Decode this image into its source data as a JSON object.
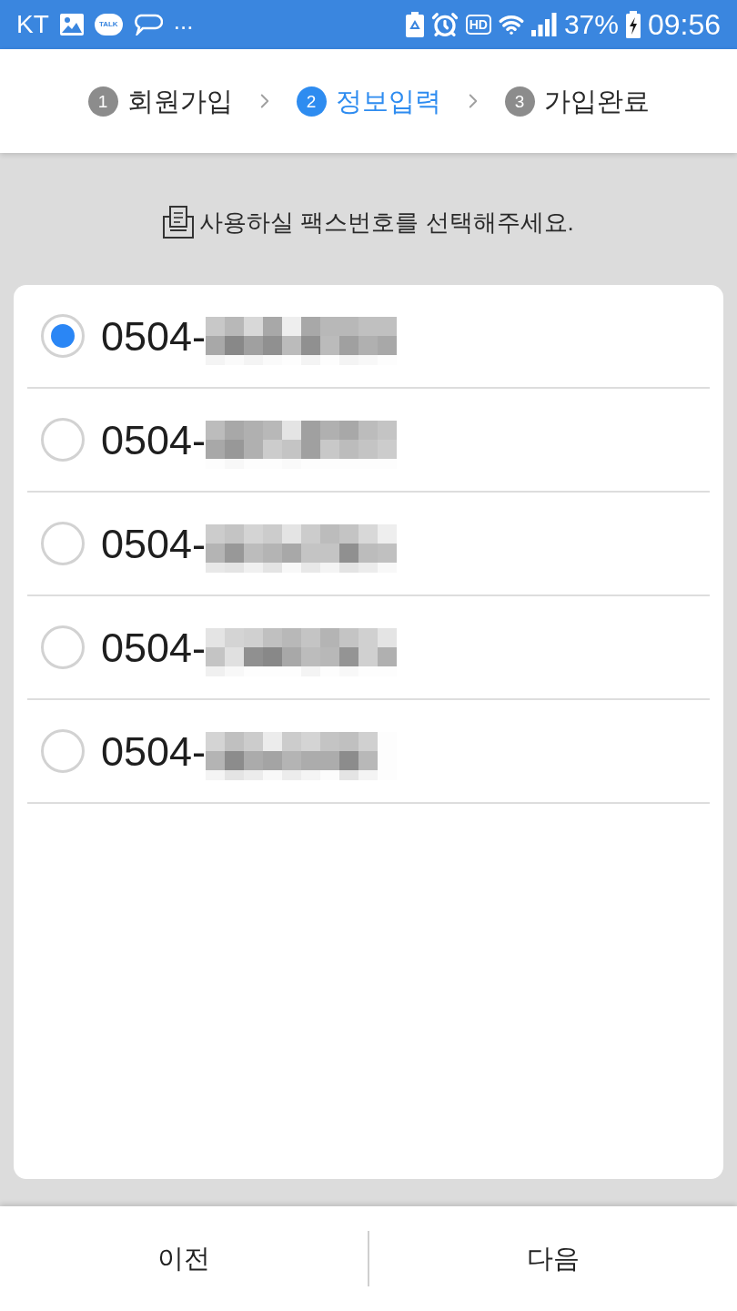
{
  "status_bar": {
    "carrier": "KT",
    "chat_badge": "TALK",
    "more": "...",
    "hd_label": "HD",
    "battery_percent": "37%",
    "time": "09:56"
  },
  "steps": [
    {
      "number": "1",
      "label": "회원가입",
      "selected": false
    },
    {
      "number": "2",
      "label": "정보입력",
      "selected": true
    },
    {
      "number": "3",
      "label": "가입완료",
      "selected": false
    }
  ],
  "instruction": "사용하실 팩스번호를 선택해주세요.",
  "fax_numbers": [
    {
      "number": "0504-",
      "selected": true
    },
    {
      "number": "0504-",
      "selected": false
    },
    {
      "number": "0504-",
      "selected": false
    },
    {
      "number": "0504-",
      "selected": false
    },
    {
      "number": "0504-",
      "selected": false
    }
  ],
  "buttons": [
    "이전",
    "다음"
  ]
}
